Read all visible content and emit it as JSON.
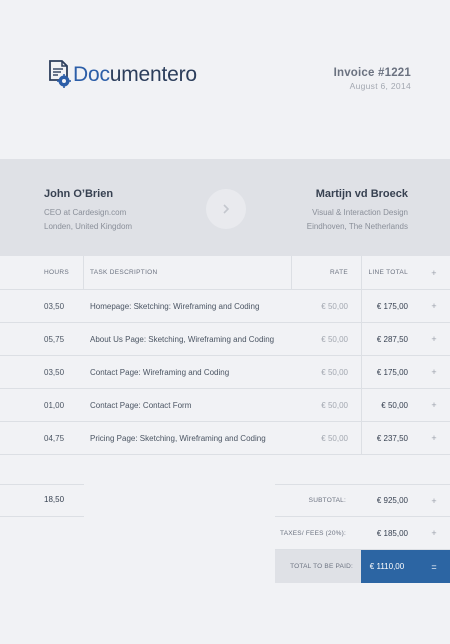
{
  "brand": {
    "name_part1": "Doc",
    "name_part2": "umentero",
    "accent": "#2c5ea8"
  },
  "invoice": {
    "title": "Invoice #1221",
    "date": "August 6, 2014"
  },
  "sender": {
    "name": "John O’Brien",
    "role": "CEO at Cardesign.com",
    "location": "Londen, United Kingdom"
  },
  "recipient": {
    "name": "Martijn vd Broeck",
    "role": "Visual & Interaction Design",
    "location": "Eindhoven, The Netherlands"
  },
  "table": {
    "headers": {
      "hours": "HOURS",
      "description": "TASK DESCRIPTION",
      "rate": "RATE",
      "line_total": "LINE TOTAL",
      "add": "+"
    },
    "rows": [
      {
        "hours": "03,50",
        "description": "Homepage: Sketching: Wireframing and Coding",
        "rate": "€ 50,00",
        "total": "€ 175,00",
        "add": "+"
      },
      {
        "hours": "05,75",
        "description": "About Us Page: Sketching, Wireframing and Coding",
        "rate": "€ 50,00",
        "total": "€ 287,50",
        "add": "+"
      },
      {
        "hours": "03,50",
        "description": "Contact Page: Wireframing and Coding",
        "rate": "€ 50,00",
        "total": "€ 175,00",
        "add": "+"
      },
      {
        "hours": "01,00",
        "description": "Contact Page: Contact Form",
        "rate": "€ 50,00",
        "total": "€ 50,00",
        "add": "+"
      },
      {
        "hours": "04,75",
        "description": "Pricing Page: Sketching,  Wireframing and Coding",
        "rate": "€ 50,00",
        "total": "€ 237,50",
        "add": "+"
      }
    ]
  },
  "summary": {
    "total_hours": "18,50",
    "subtotal_label": "SUBTOTAL:",
    "subtotal_value": "€ 925,00",
    "subtotal_add": "+",
    "taxes_label": "TAXES/ FEES (20%):",
    "taxes_value": "€ 185,00",
    "taxes_add": "+",
    "pay_label": "TOTAL TO BE PAID:",
    "pay_value": "€ 1110,00",
    "pay_equals": "="
  },
  "colors": {
    "background": "#f1f2f5",
    "band": "#dfe1e6",
    "total_highlight": "#2c65a3"
  }
}
